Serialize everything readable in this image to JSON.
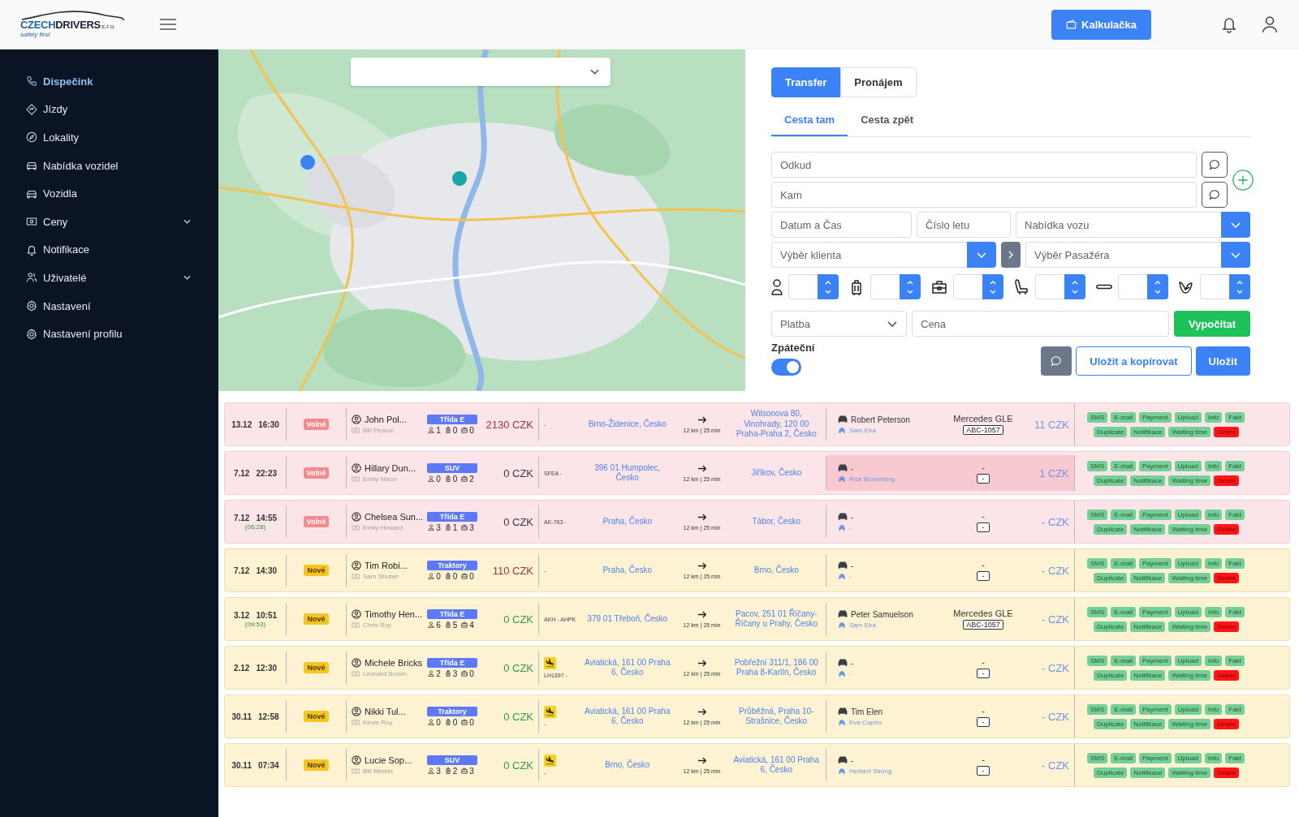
{
  "header": {
    "logo": {
      "name_1": "CZECH",
      "name_2": "DRIVERS",
      "suffix": "s.r.o.",
      "tagline": "safety first"
    },
    "calculator_button": "Kalkulačka"
  },
  "sidebar": {
    "items": [
      {
        "label": "Dispečink",
        "selected": true,
        "expandable": false
      },
      {
        "label": "Jízdy",
        "selected": false,
        "expandable": false
      },
      {
        "label": "Lokality",
        "selected": false,
        "expandable": false
      },
      {
        "label": "Nabídka vozidel",
        "selected": false,
        "expandable": false
      },
      {
        "label": "Vozidla",
        "selected": false,
        "expandable": false
      },
      {
        "label": "Ceny",
        "selected": false,
        "expandable": true
      },
      {
        "label": "Notifikace",
        "selected": false,
        "expandable": false
      },
      {
        "label": "Uživatelé",
        "selected": false,
        "expandable": true
      },
      {
        "label": "Nastavení",
        "selected": false,
        "expandable": false
      },
      {
        "label": "Nastavení profilu",
        "selected": false,
        "expandable": false
      }
    ]
  },
  "form": {
    "mode_tabs": [
      {
        "label": "Transfer",
        "selected": true
      },
      {
        "label": "Pronájem",
        "selected": false
      }
    ],
    "direction_tabs": [
      {
        "label": "Cesta tam",
        "selected": true
      },
      {
        "label": "Cesta zpět",
        "selected": false
      }
    ],
    "from": {
      "placeholder": "Odkud"
    },
    "to": {
      "placeholder": "Kam"
    },
    "datetime": {
      "placeholder": "Datum a Čas"
    },
    "flight": {
      "placeholder": "Číslo letu"
    },
    "vehicle_offer": {
      "placeholder": "Nabídka vozu"
    },
    "client": {
      "placeholder": "Výběr klienta"
    },
    "passenger": {
      "placeholder": "Výběr Pasažéra"
    },
    "payment": {
      "placeholder": "Platba"
    },
    "price": {
      "placeholder": "Cena"
    },
    "calculate_button": "Vypočítat",
    "return_trip": {
      "label": "Zpáteční",
      "on": true
    },
    "save_copy_button": "Uložit a kopírovat",
    "save_button": "Uložit"
  },
  "table": {
    "rows": [
      {
        "date": "13.12",
        "time": "16:30",
        "status": {
          "label": "Volné",
          "kind": "free"
        },
        "client": "John Pol...",
        "passenger": "Bill Pearce",
        "vehicle_class": "Třída E",
        "pax": "1",
        "luggage": "0",
        "hand_luggage": "0",
        "price": {
          "text": "2130 CZK",
          "kind": "due"
        },
        "flight": "-",
        "flight_arrival": false,
        "from": "Brno-Židenice, Česko",
        "distance": "12 km | 25 min",
        "to": "Wilsonova 80, Vinohrady, 120 00 Praha-Praha 2, Česko",
        "driver": "Robert Peterson",
        "dispatcher": "Sam Eira",
        "car": "Mercedes GLE",
        "plate": "ABC-1057",
        "driver_price": "11 CZK",
        "highlighted": false,
        "actions": [
          {
            "label": "SMS",
            "kind": "action"
          },
          {
            "label": "E-mail",
            "kind": "action"
          },
          {
            "label": "Payment",
            "kind": "action"
          },
          {
            "label": "Upload",
            "kind": "action"
          },
          {
            "label": "Info",
            "kind": "action"
          },
          {
            "label": "Fakt",
            "kind": "action"
          },
          {
            "label": "Duplicate",
            "kind": "action"
          },
          {
            "label": "Notifikace",
            "kind": "action"
          },
          {
            "label": "Waiting time",
            "kind": "action"
          },
          {
            "label": "Delete",
            "kind": "danger"
          }
        ]
      },
      {
        "date": "7.12",
        "time": "22:23",
        "status": {
          "label": "Volné",
          "kind": "free"
        },
        "client": "Hillary Dun...",
        "passenger": "Emily Nixon",
        "vehicle_class": "SUV",
        "pax": "0",
        "luggage": "0",
        "hand_luggage": "2",
        "price": {
          "text": "0 CZK",
          "kind": "none"
        },
        "flight": "SFEA -",
        "flight_arrival": false,
        "from": "396 01 Humpolec, Česko",
        "distance": "12 km | 25 min",
        "to": "Jiříkov, Česko",
        "driver": "-",
        "dispatcher": "Rick Bloomberg",
        "car": "-",
        "plate": "-",
        "driver_price": "1 CZK",
        "highlighted": true,
        "actions": [
          {
            "label": "SMS",
            "kind": "action"
          },
          {
            "label": "E-mail",
            "kind": "action"
          },
          {
            "label": "Payment",
            "kind": "action"
          },
          {
            "label": "Upload",
            "kind": "action"
          },
          {
            "label": "Info",
            "kind": "action"
          },
          {
            "label": "Fakt",
            "kind": "action"
          },
          {
            "label": "Duplicate",
            "kind": "action"
          },
          {
            "label": "Notifikace",
            "kind": "action"
          },
          {
            "label": "Waiting time",
            "kind": "action"
          },
          {
            "label": "Delete",
            "kind": "danger"
          }
        ]
      },
      {
        "date": "7.12",
        "time": "14:55",
        "countdown": "(06:28)",
        "status": {
          "label": "Volné",
          "kind": "free"
        },
        "client": "Chelsea Sun...",
        "passenger": "Emily Howard",
        "vehicle_class": "Třída E",
        "pax": "3",
        "luggage": "1",
        "hand_luggage": "3",
        "price": {
          "text": "0 CZK",
          "kind": "none"
        },
        "flight": "AK-763 -",
        "flight_arrival": false,
        "from": "Praha, Česko",
        "distance": "12 km | 25 min",
        "to": "Tábor, Česko",
        "driver": "-",
        "dispatcher": "-",
        "car": "-",
        "plate": "-",
        "driver_price": "- CZK",
        "highlighted": false,
        "actions": [
          {
            "label": "SMS",
            "kind": "action"
          },
          {
            "label": "E-mail",
            "kind": "action"
          },
          {
            "label": "Payment",
            "kind": "action"
          },
          {
            "label": "Upload",
            "kind": "action"
          },
          {
            "label": "Info",
            "kind": "action"
          },
          {
            "label": "Fakt",
            "kind": "action"
          },
          {
            "label": "Duplicate",
            "kind": "action"
          },
          {
            "label": "Notifikace",
            "kind": "action"
          },
          {
            "label": "Waiting time",
            "kind": "action"
          },
          {
            "label": "Delete",
            "kind": "danger"
          }
        ]
      },
      {
        "date": "7.12",
        "time": "14:30",
        "status": {
          "label": "Nové",
          "kind": "new"
        },
        "client": "Tim Robi...",
        "passenger": "Sam Shuber",
        "vehicle_class": "Traktory",
        "pax": "0",
        "luggage": "0",
        "hand_luggage": "0",
        "price": {
          "text": "110 CZK",
          "kind": "due"
        },
        "flight": "-",
        "flight_arrival": false,
        "from": "Praha, Česko",
        "distance": "12 km | 25 min",
        "to": "Brno, Česko",
        "driver": "-",
        "dispatcher": "-",
        "car": "-",
        "plate": "-",
        "driver_price": "- CZK",
        "highlighted": false,
        "actions": [
          {
            "label": "SMS",
            "kind": "action"
          },
          {
            "label": "E-mail",
            "kind": "action"
          },
          {
            "label": "Payment",
            "kind": "action"
          },
          {
            "label": "Upload",
            "kind": "action"
          },
          {
            "label": "Info",
            "kind": "action"
          },
          {
            "label": "Fakt",
            "kind": "action"
          },
          {
            "label": "Duplicate",
            "kind": "action"
          },
          {
            "label": "Notifikace",
            "kind": "action"
          },
          {
            "label": "Waiting time",
            "kind": "action"
          },
          {
            "label": "Delete",
            "kind": "danger"
          }
        ]
      },
      {
        "date": "3.12",
        "time": "10:51",
        "countdown": "(09:53)",
        "status": {
          "label": "Nové",
          "kind": "new"
        },
        "client": "Timothy Hen...",
        "passenger": "Chris Roy",
        "vehicle_class": "Třída E",
        "pax": "6",
        "luggage": "5",
        "hand_luggage": "4",
        "price": {
          "text": "0 CZK",
          "kind": "paid"
        },
        "flight": "AKH - AHPK",
        "flight_arrival": false,
        "from": "379 01 Třeboň, Česko",
        "distance": "12 km | 25 min",
        "to": "Pacov, 251 01 Říčany-Říčany u Prahy, Česko",
        "driver": "Peter Samuelson",
        "dispatcher": "Sam Eira",
        "car": "Mercedes GLE",
        "plate": "ABC-1057",
        "driver_price": "- CZK",
        "highlighted": false,
        "actions": [
          {
            "label": "SMS",
            "kind": "action"
          },
          {
            "label": "E-mail",
            "kind": "action"
          },
          {
            "label": "Payment",
            "kind": "action"
          },
          {
            "label": "Upload",
            "kind": "action"
          },
          {
            "label": "Info",
            "kind": "action"
          },
          {
            "label": "Fakt",
            "kind": "action"
          },
          {
            "label": "Duplicate",
            "kind": "action"
          },
          {
            "label": "Notifikace",
            "kind": "action"
          },
          {
            "label": "Waiting time",
            "kind": "action"
          },
          {
            "label": "Delete",
            "kind": "danger"
          }
        ]
      },
      {
        "date": "2.12",
        "time": "12:30",
        "status": {
          "label": "Nové",
          "kind": "new"
        },
        "client": "Michele Bricks",
        "passenger": "Leonard Brown",
        "vehicle_class": "Třída E",
        "pax": "2",
        "luggage": "3",
        "hand_luggage": "0",
        "price": {
          "text": "0 CZK",
          "kind": "paid"
        },
        "flight": "LH1397 -",
        "flight_arrival": true,
        "from": "Aviatická, 161 00 Praha 6, Česko",
        "distance": "12 km | 25 min",
        "to": "Pobřežní 311/1, 186 00 Praha 8-Karlín, Česko",
        "driver": "-",
        "dispatcher": "-",
        "car": "-",
        "plate": "-",
        "driver_price": "- CZK",
        "highlighted": false,
        "actions": [
          {
            "label": "SMS",
            "kind": "action"
          },
          {
            "label": "E-mail",
            "kind": "action"
          },
          {
            "label": "Payment",
            "kind": "action"
          },
          {
            "label": "Upload",
            "kind": "action"
          },
          {
            "label": "Info",
            "kind": "action"
          },
          {
            "label": "Fakt",
            "kind": "action"
          },
          {
            "label": "Duplicate",
            "kind": "action"
          },
          {
            "label": "Notifikace",
            "kind": "action"
          },
          {
            "label": "Waiting time",
            "kind": "action"
          },
          {
            "label": "Delete",
            "kind": "danger"
          }
        ]
      },
      {
        "date": "30.11",
        "time": "12:58",
        "status": {
          "label": "Nové",
          "kind": "new"
        },
        "client": "Nikki Tul...",
        "passenger": "Kevin Roy",
        "vehicle_class": "Traktory",
        "pax": "0",
        "luggage": "0",
        "hand_luggage": "0",
        "price": {
          "text": "0 CZK",
          "kind": "paid"
        },
        "flight": "-",
        "flight_arrival": true,
        "from": "Aviatická, 161 00 Praha 6, Česko",
        "distance": "12 km | 25 min",
        "to": "Průběžná, Praha 10-Strašnice, Česko",
        "driver": "Tim Elen",
        "dispatcher": "Eva Caprio",
        "car": "-",
        "plate": "-",
        "driver_price": "- CZK",
        "highlighted": false,
        "actions": [
          {
            "label": "SMS",
            "kind": "action"
          },
          {
            "label": "E-mail",
            "kind": "action"
          },
          {
            "label": "Payment",
            "kind": "action"
          },
          {
            "label": "Upload",
            "kind": "action"
          },
          {
            "label": "Info",
            "kind": "action"
          },
          {
            "label": "Fakt",
            "kind": "action"
          },
          {
            "label": "Duplicate",
            "kind": "action"
          },
          {
            "label": "Notifikace",
            "kind": "action"
          },
          {
            "label": "Waiting time",
            "kind": "action"
          },
          {
            "label": "Delete",
            "kind": "danger"
          }
        ]
      },
      {
        "date": "30.11",
        "time": "07:34",
        "status": {
          "label": "Nové",
          "kind": "new"
        },
        "client": "Lucie Sop...",
        "passenger": "Bill Merkel",
        "vehicle_class": "SUV",
        "pax": "3",
        "luggage": "2",
        "hand_luggage": "3",
        "price": {
          "text": "0 CZK",
          "kind": "paid"
        },
        "flight": "-",
        "flight_arrival": true,
        "from": "Brno, Česko",
        "distance": "12 km | 25 min",
        "to": "Aviatická, 161 00 Praha 6, Česko",
        "driver": "-",
        "dispatcher": "Herbert Strong",
        "car": "-",
        "plate": "-",
        "driver_price": "- CZK",
        "highlighted": false,
        "actions": [
          {
            "label": "SMS",
            "kind": "action"
          },
          {
            "label": "E-mail",
            "kind": "action"
          },
          {
            "label": "Payment",
            "kind": "action"
          },
          {
            "label": "Upload",
            "kind": "action"
          },
          {
            "label": "Info",
            "kind": "action"
          },
          {
            "label": "Fakt",
            "kind": "action"
          },
          {
            "label": "Duplicate",
            "kind": "action"
          },
          {
            "label": "Notifikace",
            "kind": "action"
          },
          {
            "label": "Waiting time",
            "kind": "action"
          },
          {
            "label": "Delete",
            "kind": "danger"
          }
        ]
      }
    ]
  }
}
